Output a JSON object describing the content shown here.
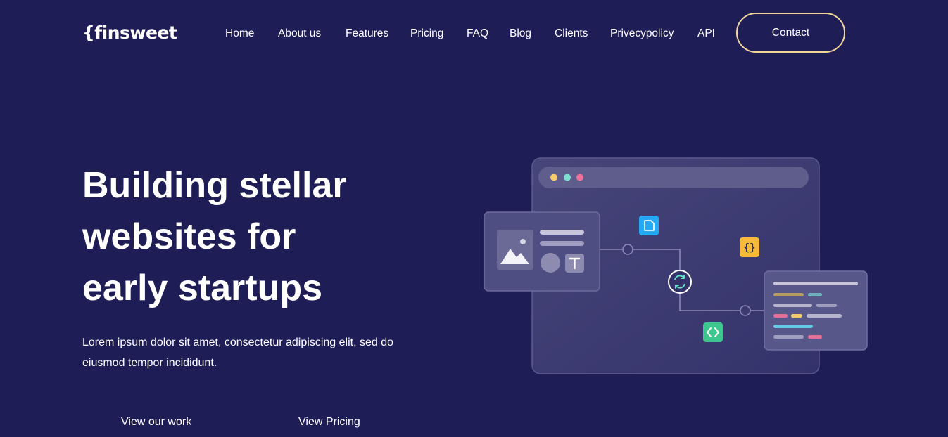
{
  "header": {
    "logo": "{finsweet",
    "nav": [
      {
        "label": "Home"
      },
      {
        "label": "About us"
      },
      {
        "label": "Features"
      },
      {
        "label": "Pricing"
      },
      {
        "label": "FAQ"
      },
      {
        "label": "Blog"
      },
      {
        "label": "Clients"
      },
      {
        "label": "Privecypolicy"
      },
      {
        "label": "API"
      }
    ],
    "contact_label": "Contact"
  },
  "hero": {
    "title_lines": [
      "Building stellar",
      "websites for",
      "early startups"
    ],
    "subtitle": "Lorem ipsum dolor sit amet, consectetur adipiscing elit, sed do eiusmod tempor incididunt.",
    "cta_primary": "View our work",
    "cta_secondary": "View Pricing"
  },
  "colors": {
    "background": "#1e1d55",
    "contact_border": "#f2d59a",
    "dot_yellow": "#f9c96b",
    "dot_teal": "#7ee0d0",
    "dot_pink": "#f0739c",
    "file_icon": "#24a9f2",
    "braces_icon": "#f7b93a",
    "code_icon": "#3fc58e"
  },
  "illustration": {
    "icons": [
      "image-icon",
      "text-icon",
      "file-icon",
      "braces-icon",
      "sync-icon",
      "code-icon"
    ]
  }
}
